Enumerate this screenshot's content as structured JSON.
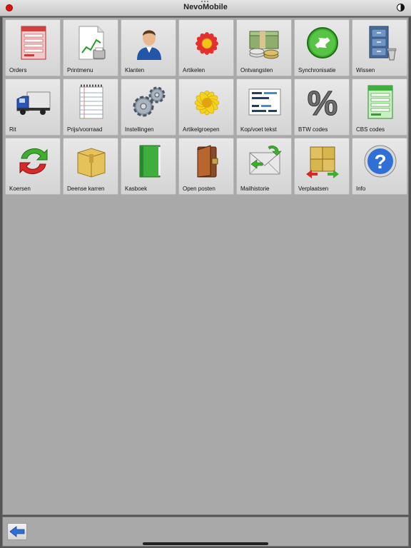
{
  "window": {
    "title": "NevoMobile"
  },
  "tiles": [
    {
      "label": "Orders",
      "icon": "order-form-icon"
    },
    {
      "label": "Printmenu",
      "icon": "print-chart-icon"
    },
    {
      "label": "Klanten",
      "icon": "customer-person-icon"
    },
    {
      "label": "Artikelen",
      "icon": "red-flower-icon"
    },
    {
      "label": "Ontvangsten",
      "icon": "money-stack-icon"
    },
    {
      "label": "Synchronisatie",
      "icon": "sync-arrows-icon"
    },
    {
      "label": "Wissen",
      "icon": "cabinet-trash-icon"
    },
    {
      "label": "Rit",
      "icon": "delivery-truck-icon"
    },
    {
      "label": "Prijs/voorraad",
      "icon": "notepad-icon"
    },
    {
      "label": "Instellingen",
      "icon": "gears-icon"
    },
    {
      "label": "Artikelgroepen",
      "icon": "yellow-flower-icon"
    },
    {
      "label": "Kop/voet tekst",
      "icon": "document-text-icon"
    },
    {
      "label": "BTW codes",
      "icon": "percent-icon"
    },
    {
      "label": "CBS codes",
      "icon": "green-form-icon"
    },
    {
      "label": "Koersen",
      "icon": "exchange-arrows-icon"
    },
    {
      "label": "Deense karren",
      "icon": "cardboard-box-icon"
    },
    {
      "label": "Kasboek",
      "icon": "green-book-icon"
    },
    {
      "label": "Open posten",
      "icon": "wallet-icon"
    },
    {
      "label": "Mailhistorie",
      "icon": "mail-refresh-icon"
    },
    {
      "label": "Verplaatsen",
      "icon": "move-boxes-icon"
    },
    {
      "label": "Info",
      "icon": "info-question-icon"
    }
  ],
  "colors": {
    "accent_back": "#2f6fd6",
    "close_red": "#e3120b",
    "panel_bg": "#a9a9a9"
  },
  "bottom": {
    "back_icon": "back-arrow-icon"
  }
}
